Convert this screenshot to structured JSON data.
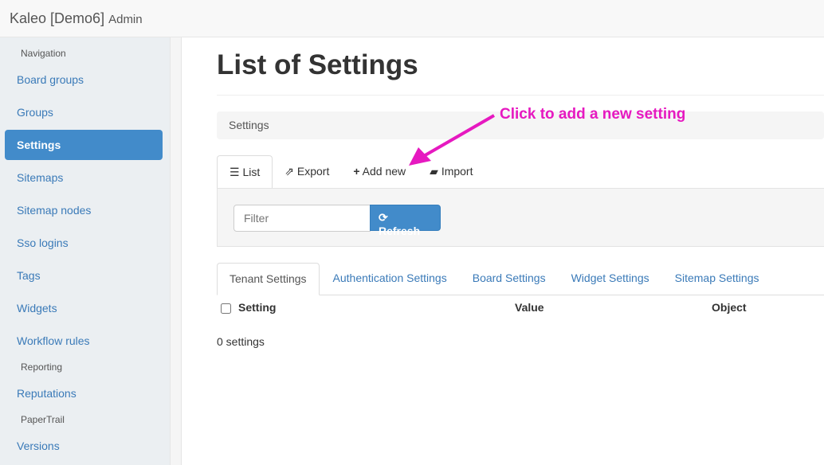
{
  "header": {
    "brand": "Kaleo [Demo6]",
    "subtitle": "Admin"
  },
  "sidebar": {
    "headings": [
      "Navigation",
      "Reporting",
      "PaperTrail"
    ],
    "items": [
      "Board groups",
      "Groups",
      "Settings",
      "Sitemaps",
      "Sitemap nodes",
      "Sso logins",
      "Tags",
      "Widgets",
      "Workflow rules",
      "Reputations",
      "Versions"
    ]
  },
  "page": {
    "title": "List of Settings",
    "breadcrumb": "Settings",
    "annotation": "Click to add a new setting"
  },
  "actions": {
    "list": "List",
    "export": "Export",
    "add_new": "Add new",
    "import": "Import"
  },
  "filter": {
    "placeholder": "Filter",
    "refresh": "Refresh"
  },
  "tabs": [
    "Tenant Settings",
    "Authentication Settings",
    "Board Settings",
    "Widget Settings",
    "Sitemap Settings"
  ],
  "table": {
    "columns": [
      "Setting",
      "Value",
      "Object"
    ],
    "count": "0 settings"
  },
  "colors": {
    "accent": "#428bca",
    "annotation": "#e619c0"
  }
}
